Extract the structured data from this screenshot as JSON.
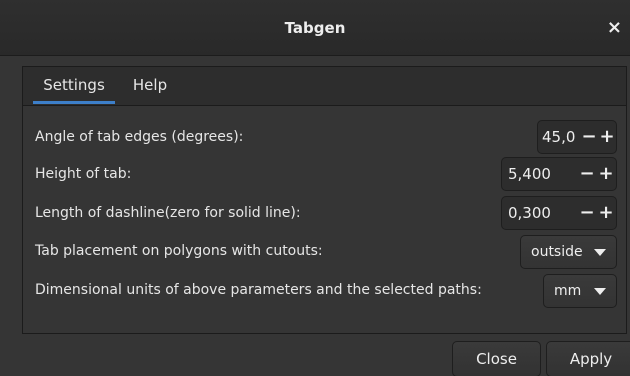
{
  "window": {
    "title": "Tabgen",
    "close_label": "×"
  },
  "tabs": [
    {
      "label": "Settings",
      "active": true
    },
    {
      "label": "Help",
      "active": false
    }
  ],
  "settings": {
    "angle": {
      "label": "Angle of tab edges (degrees):",
      "value": "45,0",
      "minus": "−",
      "plus": "+"
    },
    "height": {
      "label": "Height of tab:",
      "value": "5,400",
      "minus": "−",
      "plus": "+"
    },
    "dash": {
      "label": "Length of dashline(zero for solid line):",
      "value": "0,300",
      "minus": "−",
      "plus": "+"
    },
    "placement": {
      "label": "Tab placement on polygons with cutouts:",
      "value": "outside"
    },
    "units": {
      "label": "Dimensional units of above parameters and the selected paths:",
      "value": "mm"
    }
  },
  "buttons": {
    "close": "Close",
    "apply": "Apply"
  },
  "colors": {
    "accent": "#3d7fc9",
    "background": "#353535"
  },
  "icons": {
    "window_close": "close-icon",
    "dropdown": "chevron-down-icon"
  }
}
